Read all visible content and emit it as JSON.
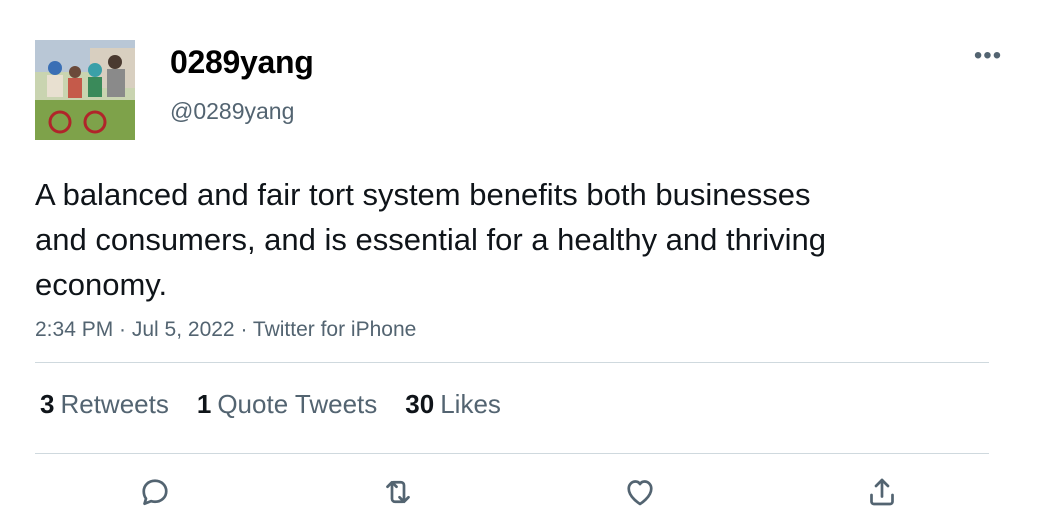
{
  "author": {
    "display_name": "0289yang",
    "handle": "@0289yang",
    "avatar_alt": "family photo with children on bikes"
  },
  "tweet": {
    "text": "A balanced and fair tort system benefits both businesses and consumers, and is essential for a healthy and thriving economy.",
    "meta": "2:34 PM · Jul 5, 2022 · Twitter for iPhone"
  },
  "stats": [
    {
      "count": "3",
      "label": "Retweets"
    },
    {
      "count": "1",
      "label": "Quote Tweets"
    },
    {
      "count": "30",
      "label": "Likes"
    }
  ],
  "actions": [
    {
      "name": "reply-button",
      "icon": "reply-icon"
    },
    {
      "name": "retweet-button",
      "icon": "retweet-icon"
    },
    {
      "name": "like-button",
      "icon": "heart-icon"
    },
    {
      "name": "share-button",
      "icon": "share-icon"
    }
  ],
  "more_menu": {
    "icon": "more-icon"
  },
  "colors": {
    "text": "#0f1419",
    "secondary": "#536471",
    "divider": "#cfd9de"
  }
}
